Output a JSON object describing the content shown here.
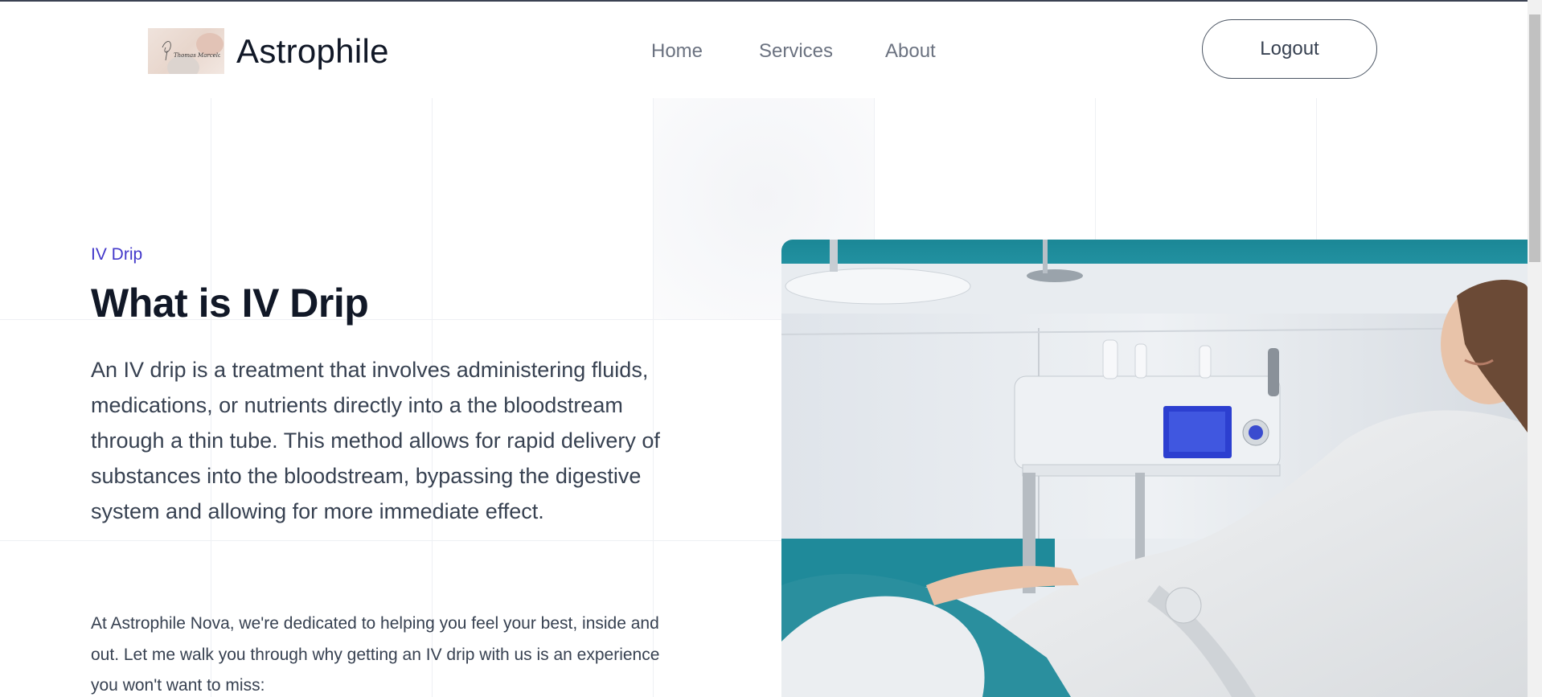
{
  "header": {
    "brand_name": "Astrophile",
    "logo_text": "Thomas Marcelo",
    "nav": [
      {
        "label": "Home"
      },
      {
        "label": "Services"
      },
      {
        "label": "About"
      }
    ],
    "logout_label": "Logout"
  },
  "hero": {
    "eyebrow": "IV Drip",
    "title": "What is IV Drip",
    "lead": "An IV drip is a treatment that involves administering fluids, medications, or nutrients directly into a the bloodstream through a thin tube. This method allows for rapid delivery of substances into the bloodstream, bypassing the digestive system and allowing for more immediate effect.",
    "body": "At Astrophile Nova, we're dedicated to helping you feel your best, inside and out. Let me walk you through why getting an IV drip with us is an experience you won't want to miss:"
  },
  "colors": {
    "accent": "#4338ca",
    "heading": "#111827",
    "text": "#374151",
    "nav": "#6b7280",
    "teal": "#1f8a9a"
  },
  "icons": {
    "logo": "brand-logo-signature",
    "hero": "woman-relaxing-iv-clinic-photo"
  }
}
